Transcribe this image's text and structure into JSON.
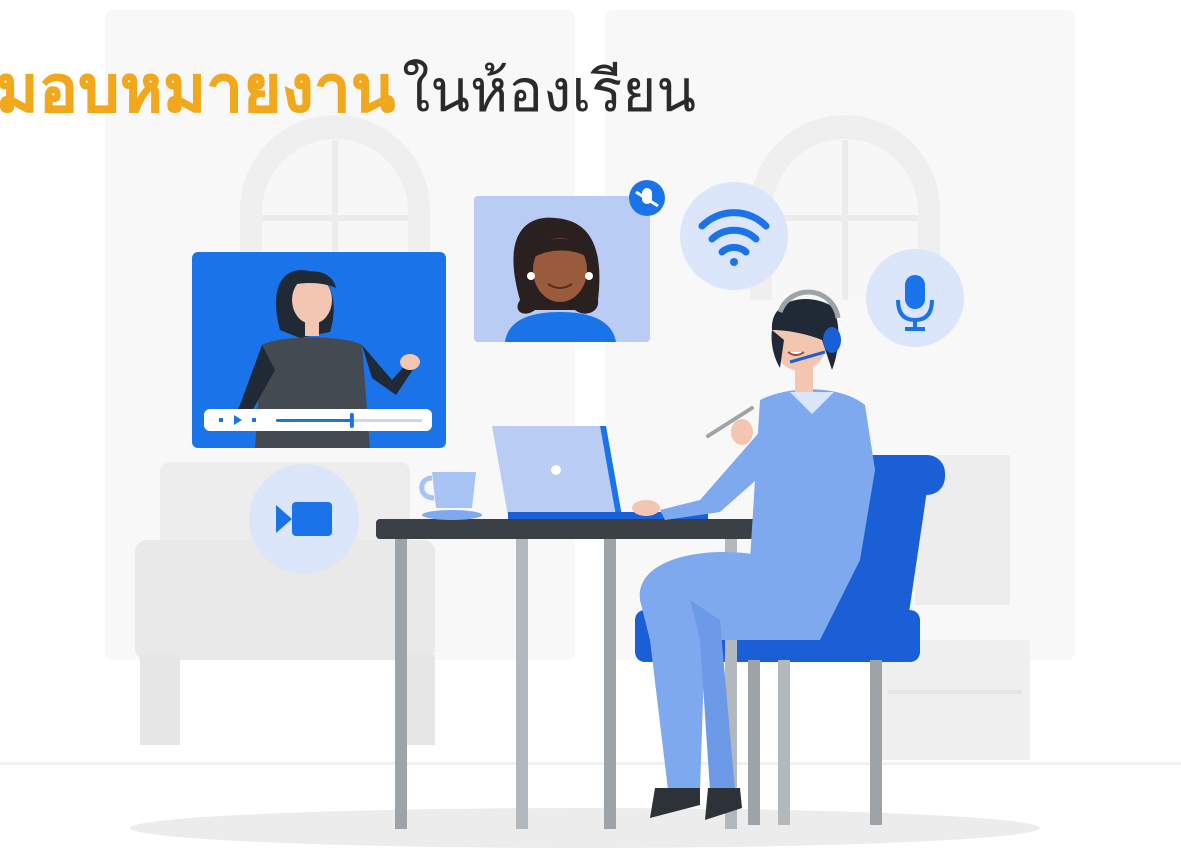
{
  "title": {
    "highlight": "มอบหมายงาน",
    "rest": "ในห้องเรียน"
  },
  "colors": {
    "highlight": "#f2a81d",
    "primary_blue": "#1a73e8",
    "light_blue": "#7fa9ef",
    "pale_blue": "#dce6fa",
    "furniture_gray": "#ededed",
    "desk_top": "#3b4046"
  },
  "icons": [
    "video-camera-icon",
    "wifi-icon",
    "microphone-icon",
    "muted-microphone-icon",
    "play-icon"
  ],
  "video_player": {
    "progress": 0.52
  }
}
